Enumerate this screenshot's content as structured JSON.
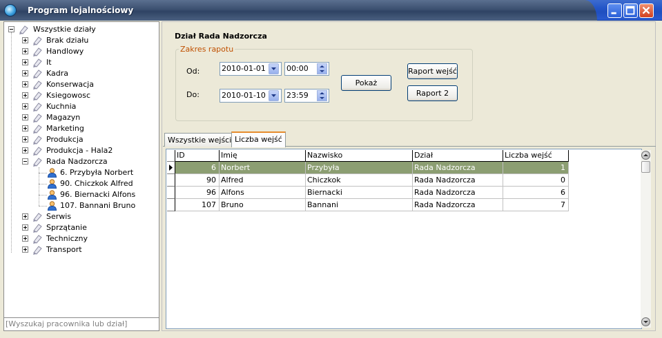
{
  "window": {
    "title": "Program lojalnościowy"
  },
  "tree": {
    "root": "Wszystkie działy",
    "items": [
      "Brak działu",
      "Handlowy",
      "It",
      "Kadra",
      "Konserwacja",
      "Ksiegowosc",
      "Kuchnia",
      "Magazyn",
      "Marketing",
      "Produkcja",
      "Produkcja - Hala2",
      "Rada Nadzorcza"
    ],
    "employees": [
      "6. Przybyła Norbert",
      "90. Chiczkok Alfred",
      "96. Biernacki Alfons",
      "107. Bannani Bruno"
    ],
    "items_after": [
      "Serwis",
      "Sprzątanie",
      "Techniczny",
      "Transport"
    ]
  },
  "search": {
    "placeholder": "[Wyszukaj pracownika lub dział]"
  },
  "panel": {
    "dept_title": "Dział Rada Nadzorcza",
    "group_label": "Zakres rapotu",
    "from_label": "Od:",
    "to_label": "Do:",
    "from_date": "2010-01-01",
    "from_time": "00:00",
    "to_date": "2010-01-10",
    "to_time": "23:59",
    "show_button": "Pokaż",
    "report1_button": "Raport wejść",
    "report2_button": "Raport 2"
  },
  "tabs": [
    {
      "label": "Wszystkie wejścia",
      "active": false
    },
    {
      "label": "Liczba wejść",
      "active": true
    }
  ],
  "grid": {
    "columns": [
      "ID",
      "Imię",
      "Nazwisko",
      "Dział",
      "Liczba wejść"
    ],
    "rows": [
      [
        "6",
        "Norbert",
        "Przybyła",
        "Rada Nadzorcza",
        "1"
      ],
      [
        "90",
        "Alfred",
        "Chiczkok",
        "Rada Nadzorcza",
        "0"
      ],
      [
        "96",
        "Alfons",
        "Biernacki",
        "Rada Nadzorcza",
        "6"
      ],
      [
        "107",
        "Bruno",
        "Bannani",
        "Rada Nadzorcza",
        "7"
      ]
    ],
    "selected_row": 0
  },
  "colors": {
    "selected_row": "#8c9e72",
    "tab_accent": "#e68b2c",
    "group_label": "#c05000"
  }
}
